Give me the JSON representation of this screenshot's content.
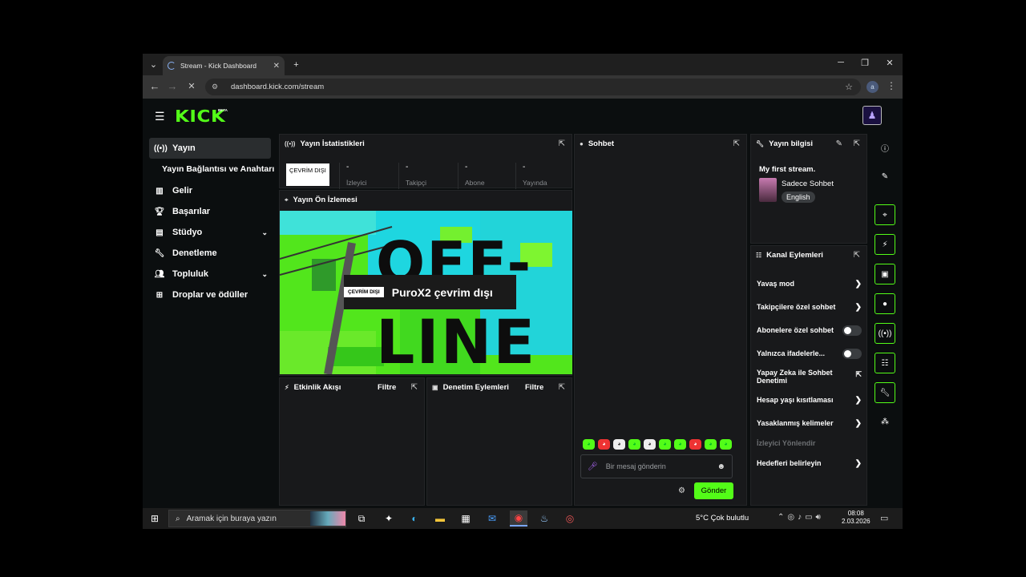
{
  "browser": {
    "tab_title": "Stream - Kick Dashboard",
    "url": "dashboard.kick.com/stream",
    "profile_initial": "a"
  },
  "app": {
    "logo_text": "KICK",
    "logo_badge": "BETA"
  },
  "nav": {
    "items": [
      {
        "label": "Yayın",
        "icon": "broadcast-icon"
      },
      {
        "label": "Yayın Bağlantısı ve Anahtarı"
      },
      {
        "label": "Gelir",
        "icon": "bar-chart-icon"
      },
      {
        "label": "Başarılar",
        "icon": "trophy-icon"
      },
      {
        "label": "Stüdyo",
        "icon": "studio-icon"
      },
      {
        "label": "Denetleme",
        "icon": "wrench-icon"
      },
      {
        "label": "Topluluk",
        "icon": "people-icon"
      },
      {
        "label": "Droplar ve ödüller",
        "icon": "gift-icon"
      }
    ]
  },
  "stats": {
    "title": "Yayın İstatistikleri",
    "status": "ÇEVRİM DIŞI",
    "items": [
      {
        "value": "-",
        "label": "İzleyici"
      },
      {
        "value": "-",
        "label": "Takipçi"
      },
      {
        "value": "-",
        "label": "Abone"
      },
      {
        "value": "-",
        "label": "Yayında"
      }
    ]
  },
  "preview": {
    "title": "Yayın Ön İzlemesi",
    "badge": "ÇEVRİM DIŞI",
    "message": "PuroX2 çevrim dışı",
    "bg_text": "OFF-LINE"
  },
  "activity": {
    "title": "Etkinlik Akışı",
    "filter": "Filtre"
  },
  "modactions": {
    "title": "Denetim Eylemleri",
    "filter": "Filtre"
  },
  "chat": {
    "title": "Sohbet",
    "placeholder": "Bir mesaj gönderin",
    "send": "Gönder"
  },
  "streaminfo": {
    "title": "Yayın bilgisi",
    "stream_title": "My first stream.",
    "category": "Sadece Sohbet",
    "language": "English"
  },
  "channel": {
    "title": "Kanal Eylemleri",
    "rows": [
      {
        "label": "Yavaş mod",
        "control": "chevron"
      },
      {
        "label": "Takipçilere özel sohbet",
        "control": "chevron"
      },
      {
        "label": "Abonelere özel sohbet",
        "control": "toggle"
      },
      {
        "label": "Yalnızca ifadelerle...",
        "control": "toggle"
      },
      {
        "label": "Yapay Zeka ile Sohbet Denetimi",
        "control": "external"
      },
      {
        "label": "Hesap yaşı kısıtlaması",
        "control": "chevron"
      },
      {
        "label": "Yasaklanmış kelimeler",
        "control": "chevron"
      },
      {
        "label": "İzleyici Yönlendir",
        "control": "none"
      },
      {
        "label": "Hedefleri belirleyin",
        "control": "chevron"
      }
    ]
  },
  "taskbar": {
    "search_placeholder": "Aramak için buraya yazın",
    "weather": "5°C  Çok bulutlu",
    "time": "08:08",
    "date": "2.03.2026"
  },
  "colors": {
    "accent": "#53fc18",
    "panel": "#18191b",
    "bg": "#0b0e0f"
  }
}
